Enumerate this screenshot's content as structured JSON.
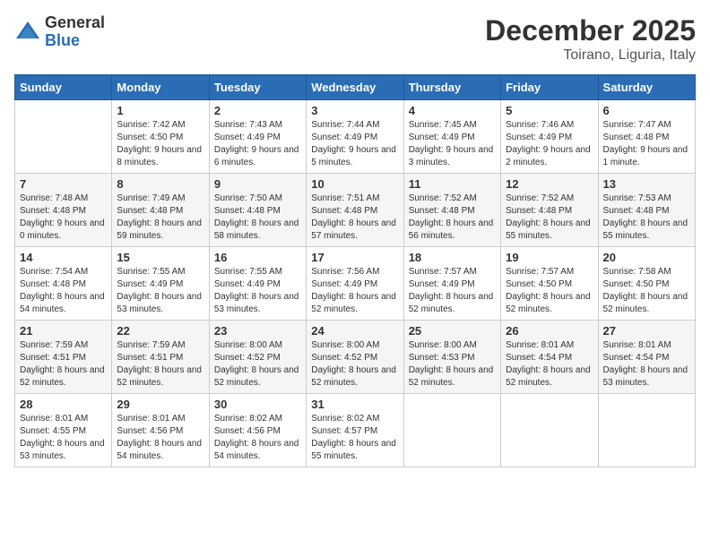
{
  "header": {
    "logo_general": "General",
    "logo_blue": "Blue",
    "month_title": "December 2025",
    "location": "Toirano, Liguria, Italy"
  },
  "days_of_week": [
    "Sunday",
    "Monday",
    "Tuesday",
    "Wednesday",
    "Thursday",
    "Friday",
    "Saturday"
  ],
  "weeks": [
    [
      {
        "day": "",
        "empty": true
      },
      {
        "day": "1",
        "sunrise": "7:42 AM",
        "sunset": "4:50 PM",
        "daylight": "9 hours and 8 minutes."
      },
      {
        "day": "2",
        "sunrise": "7:43 AM",
        "sunset": "4:49 PM",
        "daylight": "9 hours and 6 minutes."
      },
      {
        "day": "3",
        "sunrise": "7:44 AM",
        "sunset": "4:49 PM",
        "daylight": "9 hours and 5 minutes."
      },
      {
        "day": "4",
        "sunrise": "7:45 AM",
        "sunset": "4:49 PM",
        "daylight": "9 hours and 3 minutes."
      },
      {
        "day": "5",
        "sunrise": "7:46 AM",
        "sunset": "4:49 PM",
        "daylight": "9 hours and 2 minutes."
      },
      {
        "day": "6",
        "sunrise": "7:47 AM",
        "sunset": "4:48 PM",
        "daylight": "9 hours and 1 minute."
      }
    ],
    [
      {
        "day": "7",
        "sunrise": "7:48 AM",
        "sunset": "4:48 PM",
        "daylight": "9 hours and 0 minutes."
      },
      {
        "day": "8",
        "sunrise": "7:49 AM",
        "sunset": "4:48 PM",
        "daylight": "8 hours and 59 minutes."
      },
      {
        "day": "9",
        "sunrise": "7:50 AM",
        "sunset": "4:48 PM",
        "daylight": "8 hours and 58 minutes."
      },
      {
        "day": "10",
        "sunrise": "7:51 AM",
        "sunset": "4:48 PM",
        "daylight": "8 hours and 57 minutes."
      },
      {
        "day": "11",
        "sunrise": "7:52 AM",
        "sunset": "4:48 PM",
        "daylight": "8 hours and 56 minutes."
      },
      {
        "day": "12",
        "sunrise": "7:52 AM",
        "sunset": "4:48 PM",
        "daylight": "8 hours and 55 minutes."
      },
      {
        "day": "13",
        "sunrise": "7:53 AM",
        "sunset": "4:48 PM",
        "daylight": "8 hours and 55 minutes."
      }
    ],
    [
      {
        "day": "14",
        "sunrise": "7:54 AM",
        "sunset": "4:48 PM",
        "daylight": "8 hours and 54 minutes."
      },
      {
        "day": "15",
        "sunrise": "7:55 AM",
        "sunset": "4:49 PM",
        "daylight": "8 hours and 53 minutes."
      },
      {
        "day": "16",
        "sunrise": "7:55 AM",
        "sunset": "4:49 PM",
        "daylight": "8 hours and 53 minutes."
      },
      {
        "day": "17",
        "sunrise": "7:56 AM",
        "sunset": "4:49 PM",
        "daylight": "8 hours and 52 minutes."
      },
      {
        "day": "18",
        "sunrise": "7:57 AM",
        "sunset": "4:49 PM",
        "daylight": "8 hours and 52 minutes."
      },
      {
        "day": "19",
        "sunrise": "7:57 AM",
        "sunset": "4:50 PM",
        "daylight": "8 hours and 52 minutes."
      },
      {
        "day": "20",
        "sunrise": "7:58 AM",
        "sunset": "4:50 PM",
        "daylight": "8 hours and 52 minutes."
      }
    ],
    [
      {
        "day": "21",
        "sunrise": "7:59 AM",
        "sunset": "4:51 PM",
        "daylight": "8 hours and 52 minutes."
      },
      {
        "day": "22",
        "sunrise": "7:59 AM",
        "sunset": "4:51 PM",
        "daylight": "8 hours and 52 minutes."
      },
      {
        "day": "23",
        "sunrise": "8:00 AM",
        "sunset": "4:52 PM",
        "daylight": "8 hours and 52 minutes."
      },
      {
        "day": "24",
        "sunrise": "8:00 AM",
        "sunset": "4:52 PM",
        "daylight": "8 hours and 52 minutes."
      },
      {
        "day": "25",
        "sunrise": "8:00 AM",
        "sunset": "4:53 PM",
        "daylight": "8 hours and 52 minutes."
      },
      {
        "day": "26",
        "sunrise": "8:01 AM",
        "sunset": "4:54 PM",
        "daylight": "8 hours and 52 minutes."
      },
      {
        "day": "27",
        "sunrise": "8:01 AM",
        "sunset": "4:54 PM",
        "daylight": "8 hours and 53 minutes."
      }
    ],
    [
      {
        "day": "28",
        "sunrise": "8:01 AM",
        "sunset": "4:55 PM",
        "daylight": "8 hours and 53 minutes."
      },
      {
        "day": "29",
        "sunrise": "8:01 AM",
        "sunset": "4:56 PM",
        "daylight": "8 hours and 54 minutes."
      },
      {
        "day": "30",
        "sunrise": "8:02 AM",
        "sunset": "4:56 PM",
        "daylight": "8 hours and 54 minutes."
      },
      {
        "day": "31",
        "sunrise": "8:02 AM",
        "sunset": "4:57 PM",
        "daylight": "8 hours and 55 minutes."
      },
      {
        "day": "",
        "empty": true
      },
      {
        "day": "",
        "empty": true
      },
      {
        "day": "",
        "empty": true
      }
    ]
  ],
  "labels": {
    "sunrise": "Sunrise:",
    "sunset": "Sunset:",
    "daylight": "Daylight:"
  }
}
